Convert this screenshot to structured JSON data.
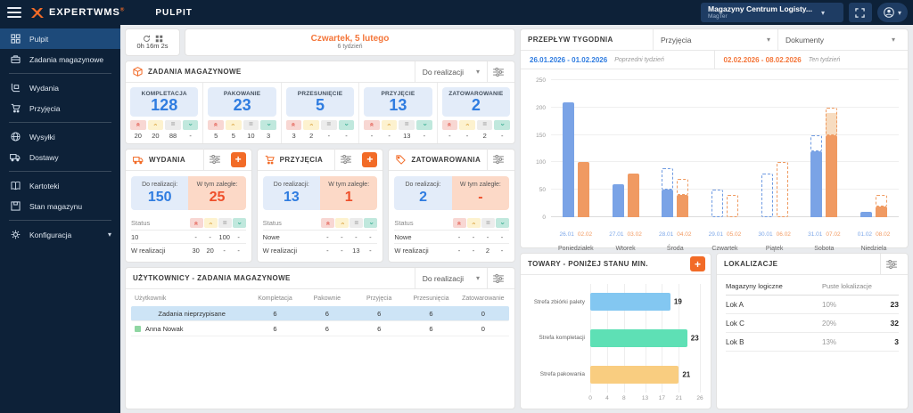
{
  "topbar": {
    "brand": "EXPERTWMS",
    "brand_reg": "®",
    "page_title": "PULPIT",
    "warehouse_selector": {
      "title": "Magazyny Centrum Logisty...",
      "subtitle": "MagTer"
    }
  },
  "sidebar": {
    "groups": [
      {
        "items": [
          {
            "label": "Pulpit",
            "icon": "dashboard",
            "active": true
          },
          {
            "label": "Zadania magazynowe",
            "icon": "briefcase"
          }
        ]
      },
      {
        "items": [
          {
            "label": "Wydania",
            "icon": "handcart"
          },
          {
            "label": "Przyjęcia",
            "icon": "cart"
          }
        ]
      },
      {
        "items": [
          {
            "label": "Wysyłki",
            "icon": "globe"
          },
          {
            "label": "Dostawy",
            "icon": "truck"
          }
        ]
      },
      {
        "items": [
          {
            "label": "Kartoteki",
            "icon": "book"
          },
          {
            "label": "Stan magazynu",
            "icon": "stock"
          }
        ]
      },
      {
        "items": [
          {
            "label": "Konfiguracja",
            "icon": "gear",
            "expandable": true
          }
        ]
      }
    ]
  },
  "timer": {
    "value": "0h 16m 2s"
  },
  "date_card": {
    "title": "Czwartek, 5 lutego",
    "subtitle": "6 tydzień"
  },
  "warehouse_tasks": {
    "title": "ZADANIA MAGAZYNOWE",
    "filter_label": "Do realizacji",
    "tiles": [
      {
        "label": "KOMPLETACJA",
        "value": "128",
        "priorities": [
          "20",
          "20",
          "88",
          "-"
        ]
      },
      {
        "label": "PAKOWANIE",
        "value": "23",
        "priorities": [
          "5",
          "5",
          "10",
          "3"
        ]
      },
      {
        "label": "PRZESUNIĘCIE",
        "value": "5",
        "priorities": [
          "3",
          "2",
          "-",
          "-"
        ]
      },
      {
        "label": "PRZYJĘCIE",
        "value": "13",
        "priorities": [
          "-",
          "-",
          "13",
          "-"
        ]
      },
      {
        "label": "ZATOWAROWANIE",
        "value": "2",
        "priorities": [
          "-",
          "-",
          "2",
          "-"
        ]
      }
    ]
  },
  "status_cards": [
    {
      "title": "WYDANIA",
      "icon": "truck",
      "has_add": true,
      "todo_label": "Do realizacji:",
      "todo": "150",
      "overdue_label": "W tym zaległe:",
      "overdue": "25",
      "status_label": "Status",
      "rows": [
        {
          "label": "10",
          "values": [
            "-",
            "-",
            "100",
            "-"
          ]
        },
        {
          "label": "W realizacji",
          "values": [
            "30",
            "20",
            "-",
            "-"
          ]
        }
      ]
    },
    {
      "title": "PRZYJĘCIA",
      "icon": "cart",
      "has_add": true,
      "todo_label": "Do realizacji:",
      "todo": "13",
      "overdue_label": "W tym zaległe:",
      "overdue": "1",
      "status_label": "Status",
      "rows": [
        {
          "label": "Nowe",
          "values": [
            "-",
            "-",
            "-",
            "-"
          ]
        },
        {
          "label": "W realizacji",
          "values": [
            "-",
            "-",
            "13",
            "-"
          ]
        }
      ]
    },
    {
      "title": "ZATOWAROWANIA",
      "icon": "tag",
      "has_add": false,
      "todo_label": "Do realizacji:",
      "todo": "2",
      "overdue_label": "W tym zaległe:",
      "overdue": "-",
      "status_label": "Status",
      "rows": [
        {
          "label": "Nowe",
          "values": [
            "-",
            "-",
            "-",
            "-"
          ]
        },
        {
          "label": "W realizacji",
          "values": [
            "-",
            "-",
            "2",
            "-"
          ]
        }
      ]
    }
  ],
  "users_table": {
    "title": "UŻYTKOWNICY - ZADANIA MAGAZYNOWE",
    "filter_label": "Do realizacji",
    "columns": [
      "Użytkownik",
      "Kompletacja",
      "Pakownie",
      "Przyjęcia",
      "Przesunięcia",
      "Zatowarowanie"
    ],
    "rows": [
      {
        "name": "Zadania nieprzypisane",
        "values": [
          "6",
          "6",
          "6",
          "6",
          "0"
        ],
        "highlight": true,
        "dot": false
      },
      {
        "name": "Anna Nowak",
        "values": [
          "6",
          "6",
          "6",
          "6",
          "0"
        ],
        "highlight": false,
        "dot": true
      }
    ]
  },
  "week_flow": {
    "title": "PRZEPŁYW TYGODNIA",
    "dropdown1": "Przyjęcia",
    "dropdown2": "Dokumenty",
    "prev_range": "26.01.2026 - 01.02.2026",
    "prev_tag": "Poprzedni tydzień",
    "curr_range": "02.02.2026 - 08.02.2026",
    "curr_tag": "Ten tydzień"
  },
  "chart_data": [
    {
      "type": "bar",
      "title": "PRZEPŁYW TYGODNIA",
      "ylim": [
        0,
        250
      ],
      "yticks": [
        0,
        50,
        100,
        150,
        200,
        250
      ],
      "legend": [
        "Poprzedni tydzień",
        "Ten tydzień"
      ],
      "days": [
        {
          "name": "Poniedziałek",
          "prev_date": "26.01",
          "curr_date": "02.02",
          "prev": {
            "solid": 210,
            "dashed": 0,
            "light": 0
          },
          "curr": {
            "solid": 100,
            "dashed": 0,
            "light": 0
          }
        },
        {
          "name": "Wtorek",
          "prev_date": "27.01",
          "curr_date": "03.02",
          "prev": {
            "solid": 60,
            "dashed": 0,
            "light": 0
          },
          "curr": {
            "solid": 80,
            "dashed": 0,
            "light": 0
          }
        },
        {
          "name": "Środa",
          "prev_date": "28.01",
          "curr_date": "04.02",
          "prev": {
            "solid": 50,
            "dashed": 90,
            "light": 0
          },
          "curr": {
            "solid": 40,
            "dashed": 70,
            "light": 0
          }
        },
        {
          "name": "Czwartek",
          "prev_date": "29.01",
          "curr_date": "05.02",
          "prev": {
            "solid": 0,
            "dashed": 50,
            "light": 0
          },
          "curr": {
            "solid": 0,
            "dashed": 40,
            "light": 0
          }
        },
        {
          "name": "Piątek",
          "prev_date": "30.01",
          "curr_date": "06.02",
          "prev": {
            "solid": 0,
            "dashed": 80,
            "light": 0
          },
          "curr": {
            "solid": 0,
            "dashed": 100,
            "light": 0
          }
        },
        {
          "name": "Sobota",
          "prev_date": "31.01",
          "curr_date": "07.02",
          "prev": {
            "solid": 120,
            "dashed": 150,
            "light": 0
          },
          "curr": {
            "solid": 150,
            "dashed": 200,
            "light": 190
          }
        },
        {
          "name": "Niedziela",
          "prev_date": "01.02",
          "curr_date": "08.02",
          "prev": {
            "solid": 10,
            "dashed": 0,
            "light": 0
          },
          "curr": {
            "solid": 20,
            "dashed": 40,
            "light": 0
          }
        }
      ],
      "colors": {
        "prev": "#7aa3e6",
        "prev_dash": "#6f9be2",
        "curr": "#f09a62",
        "curr_dash": "#ef9a60",
        "curr_light": "#f7dcc0"
      }
    },
    {
      "type": "bar",
      "orientation": "horizontal",
      "title": "TOWARY - PONIŻEJ STANU MIN.",
      "categories": [
        "Strefa zbiórki palety",
        "Strefa kompletacji",
        "Strefa pakowania"
      ],
      "values": [
        19,
        23,
        21
      ],
      "bar_colors": [
        "#83c7f1",
        "#5ee0b5",
        "#f9cd80"
      ],
      "xticks": [
        0,
        4,
        8,
        13,
        17,
        21,
        26
      ],
      "xlim": [
        0,
        26
      ]
    }
  ],
  "low_stock": {
    "title": "TOWARY - PONIŻEJ STANU MIN."
  },
  "locations": {
    "title": "LOKALIZACJE",
    "col1": "Magazyny logiczne",
    "col2": "Puste lokalizacje",
    "rows": [
      {
        "name": "Lok A",
        "percent": "10%",
        "count": "23"
      },
      {
        "name": "Lok C",
        "percent": "20%",
        "count": "32"
      },
      {
        "name": "Lok B",
        "percent": "13%",
        "count": "3"
      }
    ]
  },
  "accent_colors": {
    "orange": "#f26b27",
    "blue": "#2f7ce0",
    "navy": "#0d2138",
    "red": "#ee4f2a"
  }
}
